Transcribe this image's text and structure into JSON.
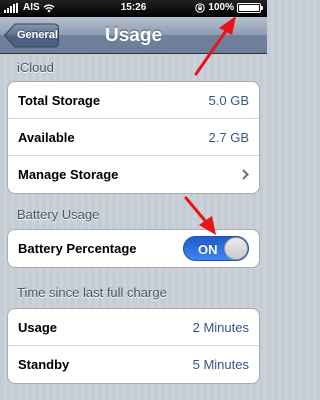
{
  "status_bar": {
    "carrier": "AIS",
    "time": "15:26",
    "battery_percent": "100%",
    "battery_level": 1.0
  },
  "nav": {
    "back_label": "General",
    "title": "Usage"
  },
  "icloud": {
    "header": "iCloud",
    "total_storage_label": "Total Storage",
    "total_storage_value": "5.0 GB",
    "available_label": "Available",
    "available_value": "2.7 GB",
    "manage_storage_label": "Manage Storage"
  },
  "battery": {
    "header": "Battery Usage",
    "percentage_label": "Battery Percentage",
    "toggle_label": "ON",
    "toggle_on": true
  },
  "charge": {
    "header": "Time since last full charge",
    "usage_label": "Usage",
    "usage_value": "2 Minutes",
    "standby_label": "Standby",
    "standby_value": "5 Minutes"
  },
  "colors": {
    "annotation_arrow": "#e8141a",
    "toggle_on": "#2f6fe0",
    "value_text": "#385487"
  },
  "icons": [
    "signal-bars-icon",
    "wifi-icon",
    "orientation-lock-icon",
    "battery-icon",
    "back-arrow-icon",
    "chevron-right-icon",
    "red-arrow-icon"
  ]
}
